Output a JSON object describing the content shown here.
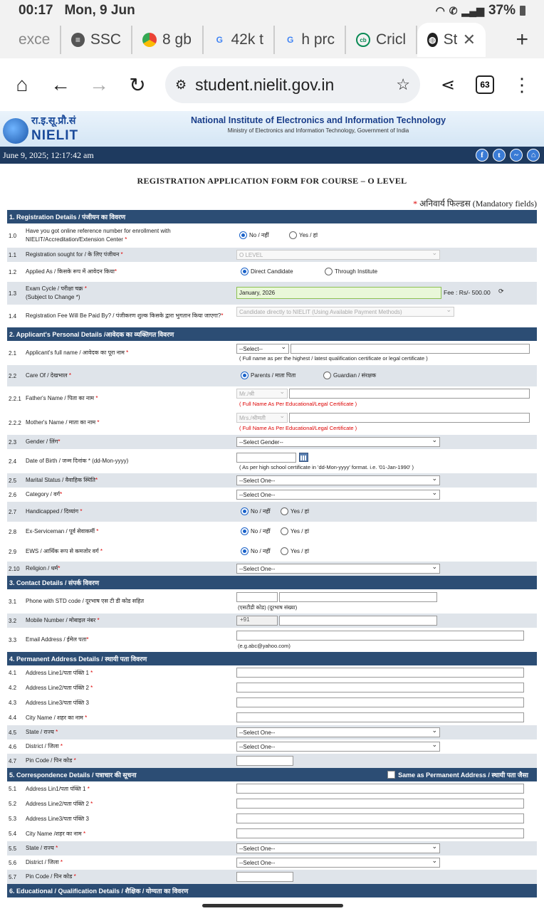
{
  "status": {
    "time": "00:17",
    "date": "Mon, 9 Jun",
    "battery": "37%"
  },
  "tabs": [
    {
      "label": "exce",
      "icon": "tab-fragment-icon"
    },
    {
      "label": "SSC",
      "icon": "ssc-icon"
    },
    {
      "label": "8 gb",
      "icon": "chrome-icon"
    },
    {
      "label": "42k t",
      "icon": "google-icon"
    },
    {
      "label": "h prc",
      "icon": "google-icon"
    },
    {
      "label": "Cricl",
      "icon": "cricbuzz-icon"
    },
    {
      "label": "Stu",
      "icon": "globe-icon"
    }
  ],
  "toolbar": {
    "url": "student.nielit.gov.in",
    "tab_count": "63"
  },
  "banner": {
    "logo_hindi": "रा.इ.सू.प्रौ.सं",
    "logo_english": "NIELIT",
    "title": "National Institute of Electronics and Information Technology",
    "subtitle": "Ministry of Electronics and Information Technology, Government of India"
  },
  "datebar": {
    "datetime": "June 9, 2025; 12:17:42 am"
  },
  "form": {
    "title": "REGISTRATION APPLICATION FORM FOR COURSE – O LEVEL",
    "mandatory": "अनिवार्य फिल्डस (Mandatory fields)",
    "s1": {
      "header": "1. Registration Details / पंजीयन का विवरण",
      "r10_num": "1.0",
      "r10_lbl": "Have you got online reference number for enrollment with NIELIT/Accreditation/Extension Center",
      "r10_no": "No / नहीं",
      "r10_yes": "Yes / हां",
      "r11_num": "1.1",
      "r11_lbl": "Registration sought for / के लिए पंजीयन",
      "r11_val": "O LEVEL",
      "r12_num": "1.2",
      "r12_lbl": "Applied As / किसके रूप में आवेदन किया",
      "r12_a": "Direct Candidate",
      "r12_b": "Through Institute",
      "r13_num": "1.3",
      "r13_lbl": "Exam Cycle / परीक्षा चक्र",
      "r13_sub": "(Subject to Change *)",
      "r13_val": "January, 2026",
      "r13_fee": "Fee : Rs/- 500.00",
      "r14_num": "1.4",
      "r14_lbl": "Registration Fee Will Be Paid By? / पंजीकरण शुल्क किसके द्वारा भुगतान किया जाएगा?",
      "r14_val": "Candidate directly to NIELIT (Using Available Payment Methods)"
    },
    "s2": {
      "header": "2. Applicant's Personal Details /आवेदक का व्यक्तिगत विवरण",
      "r21_num": "2.1",
      "r21_lbl": "Applicant's full name / आवेदक का पूरा नाम",
      "r21_sel": "--Select--",
      "r21_hint": "( Full name as per the highest / latest qualification certificate or legal certificate )",
      "r22_num": "2.2",
      "r22_lbl": "Care Of / देखभाल",
      "r22_a": "Parents / माता पिता",
      "r22_b": "Guardian / संरक्षक",
      "r221_num": "2.2.1",
      "r221_lbl": "Father's Name / पिता का नाम",
      "r221_sel": "Mr./श्री",
      "r221_hint": "( Full Name As Per Educational/Legal Certificate )",
      "r222_num": "2.2.2",
      "r222_lbl": "Mother's Name / माता का नाम",
      "r222_sel": "Mrs./श्रीमती",
      "r222_hint": "( Full Name As Per Educational/Legal Certificate )",
      "r23_num": "2.3",
      "r23_lbl": "Gender / लिंग",
      "r23_sel": "--Select Gender--",
      "r24_num": "2.4",
      "r24_lbl": "Date of Birth / जन्म दिनांक * (dd-Mon-yyyy)",
      "r24_hint": "( As per high school certificate in 'dd-Mon-yyyy' format. i.e. '01-Jan-1990' )",
      "r25_num": "2.5",
      "r25_lbl": "Marital Status / वैवाहिक स्थिति",
      "r25_sel": "--Select One--",
      "r26_num": "2.6",
      "r26_lbl": "Category / वर्ग",
      "r26_sel": "--Select One--",
      "r27_num": "2.7",
      "r27_lbl": "Handicapped / दिव्यांग",
      "r28_num": "2.8",
      "r28_lbl": "Ex-Serviceman / पूर्व सेवाकर्मी",
      "r29_num": "2.9",
      "r29_lbl": "EWS / आर्थिक रूप से कमजोर वर्ग",
      "no": "No / नहीं",
      "yes": "Yes / हां",
      "r210_num": "2.10",
      "r210_lbl": "Religion / धर्म",
      "r210_sel": "--Select One--"
    },
    "s3": {
      "header": "3. Contact Details / संपर्क विवरण",
      "r31_num": "3.1",
      "r31_lbl": "Phone with STD code / दूरभाष एस टी डी कोड सहित",
      "r31_hint": "(एसटीडी कोड) (दूरभाष संख्या)",
      "r32_num": "3.2",
      "r32_lbl": "Mobile Number / मोबाइल नंबर",
      "r32_prefix": "+91",
      "r33_num": "3.3",
      "r33_lbl": "Email Address / ईमेल पता",
      "r33_hint": "(e.g.abc@yahoo.com)"
    },
    "s4": {
      "header": "4. Permanent Address Details / स्थायी पता विवरण",
      "r41_num": "4.1",
      "r41_lbl": "Address Line1/पता पंक्ति 1",
      "r42_num": "4.2",
      "r42_lbl": "Address Line2/पता पंक्ति 2",
      "r43_num": "4.3",
      "r43_lbl": "Address Line3/पता पंक्ति 3",
      "r44_num": "4.4",
      "r44_lbl": "City Name / शहर का नाम",
      "r45_num": "4.5",
      "r45_lbl": "State / राज्य",
      "r45_sel": "--Select One--",
      "r46_num": "4.6",
      "r46_lbl": "District / जिला",
      "r46_sel": "--Select One--",
      "r47_num": "4.7",
      "r47_lbl": "Pin Code / पिन कोड"
    },
    "s5": {
      "header": "5. Correspondence Details / पत्राचार की सूचना",
      "same": "Same as Permanent Address / स्थायी पता जैसा",
      "r51_num": "5.1",
      "r51_lbl": "Address Lin1/पता पंक्ति 1",
      "r52_num": "5.2",
      "r52_lbl": "Address Line2/पता पंक्ति 2",
      "r53_num": "5.3",
      "r53_lbl": "Address Line3/पता पंक्ति 3",
      "r54_num": "5.4",
      "r54_lbl": "City Name /शहर का नाम",
      "r55_num": "5.5",
      "r55_lbl": "State / राज्य",
      "r55_sel": "--Select One--",
      "r56_num": "5.6",
      "r56_lbl": "District / जिला",
      "r56_sel": "--Select One--",
      "r57_num": "5.7",
      "r57_lbl": "Pin Code / पिन कोड"
    },
    "s6": {
      "header": "6. Educational / Qualification Details / शैक्षिक / योग्यता का विवरण"
    }
  }
}
